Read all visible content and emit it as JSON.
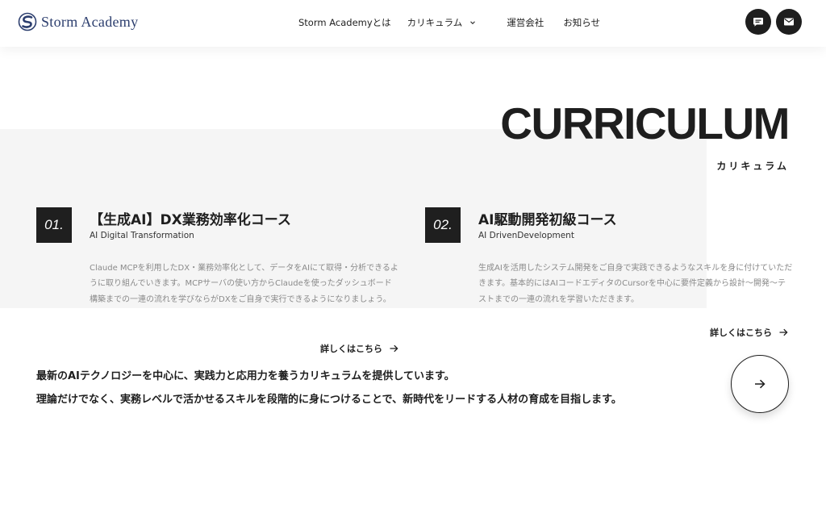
{
  "brand": {
    "name": "Storm Academy",
    "color": "#2c3e6e"
  },
  "nav": {
    "items": [
      {
        "label": "Storm Academyとは"
      },
      {
        "label": "カリキュラム"
      },
      {
        "label": "運営会社"
      },
      {
        "label": "お知らせ"
      }
    ]
  },
  "header_actions": {
    "chat_icon": "chat-bubble-icon",
    "mail_icon": "envelope-icon"
  },
  "section": {
    "title": "CURRICULUM",
    "subtitle": "カリキュラム"
  },
  "courses": [
    {
      "number": "01.",
      "title": "【生成AI】DX業務効率化コース",
      "subtitle": "AI Digital Transformation",
      "description": "Claude MCPを利用したDX・業務効率化として、データをAIにて取得・分析できるように取り組んでいきます。MCPサーバの使い方からClaudeを使ったダッシュボード構築までの一連の流れを学びならがDXをご自身で実行できるようになりましょう。",
      "link": "詳しくはこちら"
    },
    {
      "number": "02.",
      "title": "AI駆動開発初級コース",
      "subtitle": "AI DrivenDevelopment",
      "description": "生成AIを活用したシステム開発をご自身で実践できるようなスキルを身に付けていただきます。基本的にはAIコードエディタのCursorを中心に要件定義から設計〜開発〜テストまでの一連の流れを学習いただきます。",
      "link": "詳しくはこちら"
    }
  ],
  "intro": {
    "line1": "最新のAIテクノロジーを中心に、実践力と応用力を養うカリキュラムを提供しています。",
    "line2": "理論だけでなく、実務レベルで活かせるスキルを段階的に身につけることで、新時代をリードする人材の育成を目指します。"
  },
  "colors": {
    "dark": "#1e1e1e",
    "panel": "#f5f5f5",
    "muted_text": "#8a8a8a"
  }
}
